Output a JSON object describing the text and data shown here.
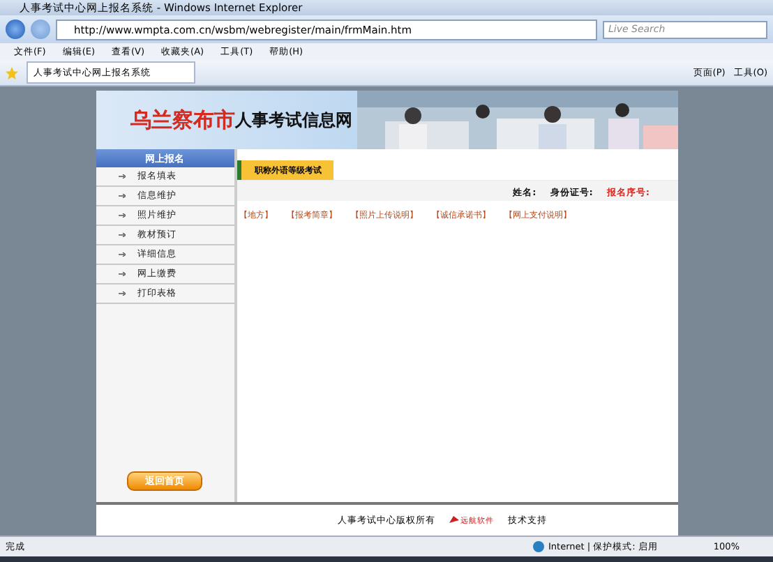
{
  "window": {
    "title": "人事考试中心网上报名系统 - Windows Internet Explorer"
  },
  "address_bar": {
    "url": "http://www.wmpta.com.cn/wsbm/webregister/main/frmMain.htm"
  },
  "search": {
    "placeholder": "Live Search"
  },
  "menu": [
    "文件(F)",
    "编辑(E)",
    "查看(V)",
    "收藏夹(A)",
    "工具(T)",
    "帮助(H)"
  ],
  "browser_tab": {
    "title": "人事考试中心网上报名系统"
  },
  "command_bar": [
    "页面(P)",
    "工具(O)"
  ],
  "banner": {
    "city": "乌兰察布市",
    "title": "人事考试信息网"
  },
  "sidebar": {
    "header": "网上报名",
    "items": [
      "报名填表",
      "信息维护",
      "照片维护",
      "教材预订",
      "详细信息",
      "网上缴费",
      "打印表格"
    ],
    "button": "返回首页"
  },
  "content": {
    "tab": "职称外语等级考试",
    "fields": [
      {
        "label": "姓名:",
        "kind": "plain"
      },
      {
        "label": "身份证号:",
        "kind": "plain"
      },
      {
        "label": "报名序号:",
        "kind": "highlight"
      }
    ],
    "links": [
      "【地方】",
      "【报考简章】",
      "【照片上传说明】",
      "【诚信承诺书】",
      "【网上支付说明】"
    ]
  },
  "footer": {
    "copyright": "人事考试中心版权所有",
    "logo": "远航软件",
    "support": "技术支持"
  },
  "status_bar": {
    "left": "完成",
    "zone": "Internet | 保护模式: 启用",
    "zoom": "100%"
  }
}
